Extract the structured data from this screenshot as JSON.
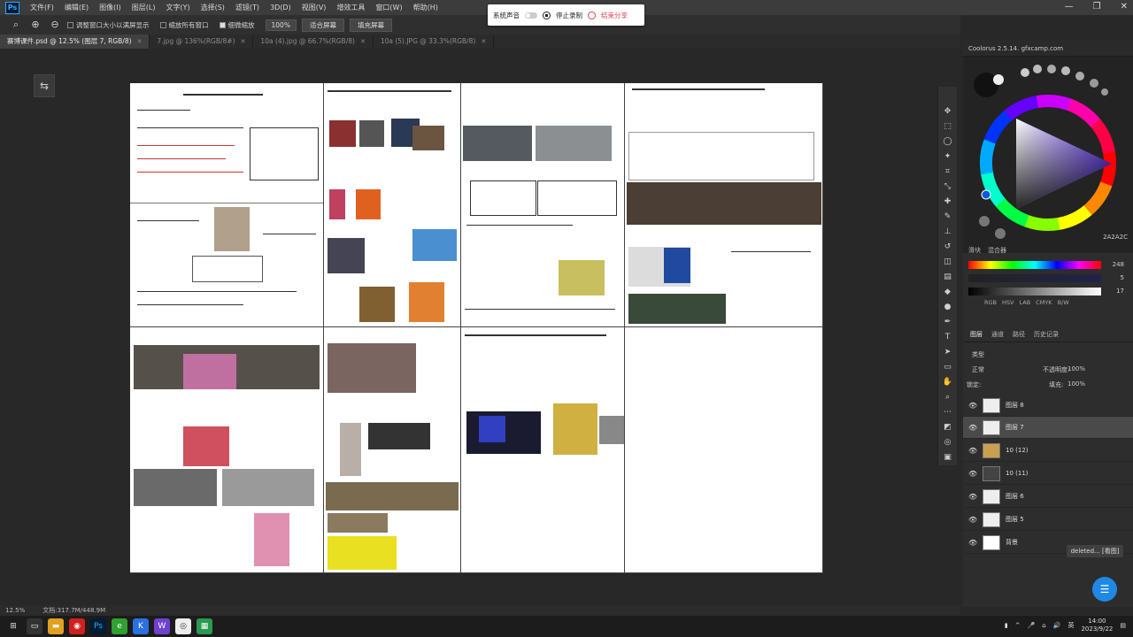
{
  "menubar": {
    "items": [
      "文件(F)",
      "编辑(E)",
      "图像(I)",
      "图层(L)",
      "文字(Y)",
      "选择(S)",
      "滤镜(T)",
      "3D(D)",
      "视图(V)",
      "增效工具",
      "窗口(W)",
      "帮助(H)"
    ]
  },
  "optionsbar": {
    "resize_windows_label": "调整窗口大小以满屏显示",
    "zoom_all_label": "缩放所有窗口",
    "scrubby_zoom_label": "细微缩放",
    "zoom_value": "100%",
    "fit_screen_label": "适合屏幕",
    "fill_screen_label": "填充屏幕"
  },
  "recorder": {
    "system_audio_label": "系统声音",
    "stop_label": "停止录制",
    "end_label": "结束分享"
  },
  "tabs": [
    {
      "label": "赛博课件.psd @ 12.5% (图层 7, RGB/8)",
      "active": true
    },
    {
      "label": "7.jpg @ 136%(RGB/8#)",
      "active": false
    },
    {
      "label": "10a (4).jpg @ 66.7%(RGB/8)",
      "active": false
    },
    {
      "label": "10a (5).JPG @ 33.3%(RGB/8)",
      "active": false
    }
  ],
  "coolorus": {
    "title": "Coolorus 2.5.14. gfxcamp.com",
    "hex": "2A2A2C",
    "slider_tabs": [
      "滑块",
      "混合器"
    ],
    "sliders": [
      {
        "value": "248",
        "kind": "hue"
      },
      {
        "value": "5",
        "kind": "sat"
      },
      {
        "value": "17",
        "kind": "bri"
      }
    ],
    "models": [
      "RGB",
      "HSV",
      "LAB",
      "CMYK",
      "B/W"
    ],
    "accent": "#e8e8e8"
  },
  "layers_panel": {
    "tabs": [
      "图层",
      "通道",
      "路径",
      "历史记录"
    ],
    "kind_label": "类型",
    "blend_mode": "正常",
    "opacity_label": "不透明度:",
    "opacity_value": "100%",
    "lock_label": "锁定:",
    "fill_label": "填充:",
    "fill_value": "100%",
    "layers": [
      {
        "name": "图层 8",
        "selected": false
      },
      {
        "name": "图层 7",
        "selected": true
      },
      {
        "name": "10 (12)",
        "selected": false
      },
      {
        "name": "10 (11)",
        "selected": false
      },
      {
        "name": "图层 6",
        "selected": false
      },
      {
        "name": "图层 5",
        "selected": false
      },
      {
        "name": "背景",
        "selected": false
      }
    ]
  },
  "status": {
    "zoom": "12.5%",
    "doc_info": "文档:317.7M/448.9M"
  },
  "overlay": {
    "badge": "deleted... [看图]"
  },
  "taskbar": {
    "time": "14:00",
    "date": "2023/9/22",
    "ime": "英"
  }
}
